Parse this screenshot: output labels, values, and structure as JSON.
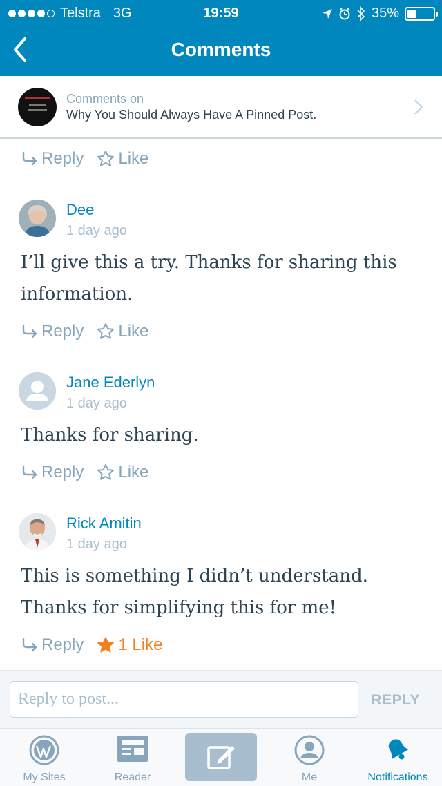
{
  "status_bar": {
    "carrier": "Telstra",
    "network": "3G",
    "time": "19:59",
    "battery": "35%",
    "battery_level": 0.35,
    "signal_bars": 4
  },
  "nav": {
    "title": "Comments"
  },
  "post": {
    "label": "Comments on",
    "title": "Why You Should Always Have A Pinned Post."
  },
  "top_actions": {
    "reply": "Reply",
    "like": "Like"
  },
  "comments": [
    {
      "author": "Dee",
      "date": "1 day ago",
      "text": "I’ll give this a try. Thanks for sharing this information.",
      "reply": "Reply",
      "like": "Like"
    },
    {
      "author": "Jane Ederlyn",
      "date": "1 day ago",
      "text": "Thanks for sharing.",
      "reply": "Reply",
      "like": "Like"
    },
    {
      "author": "Rick Amitin",
      "date": "1 day ago",
      "text": "This is something I didn’t understand. Thanks for simplifying this for me!",
      "reply": "Reply",
      "like": "1 Like"
    }
  ],
  "reply_box": {
    "placeholder": "Reply to post...",
    "submit": "REPLY"
  },
  "tabs": [
    {
      "label": "My Sites",
      "icon": "wordpress-icon"
    },
    {
      "label": "Reader",
      "icon": "reader-icon"
    },
    {
      "label": "",
      "icon": "write-icon"
    },
    {
      "label": "Me",
      "icon": "me-icon"
    },
    {
      "label": "Notifications",
      "icon": "bell-icon"
    }
  ],
  "colors": {
    "brand": "#0087be",
    "liked": "#f0821e",
    "muted": "#87a6bc"
  }
}
